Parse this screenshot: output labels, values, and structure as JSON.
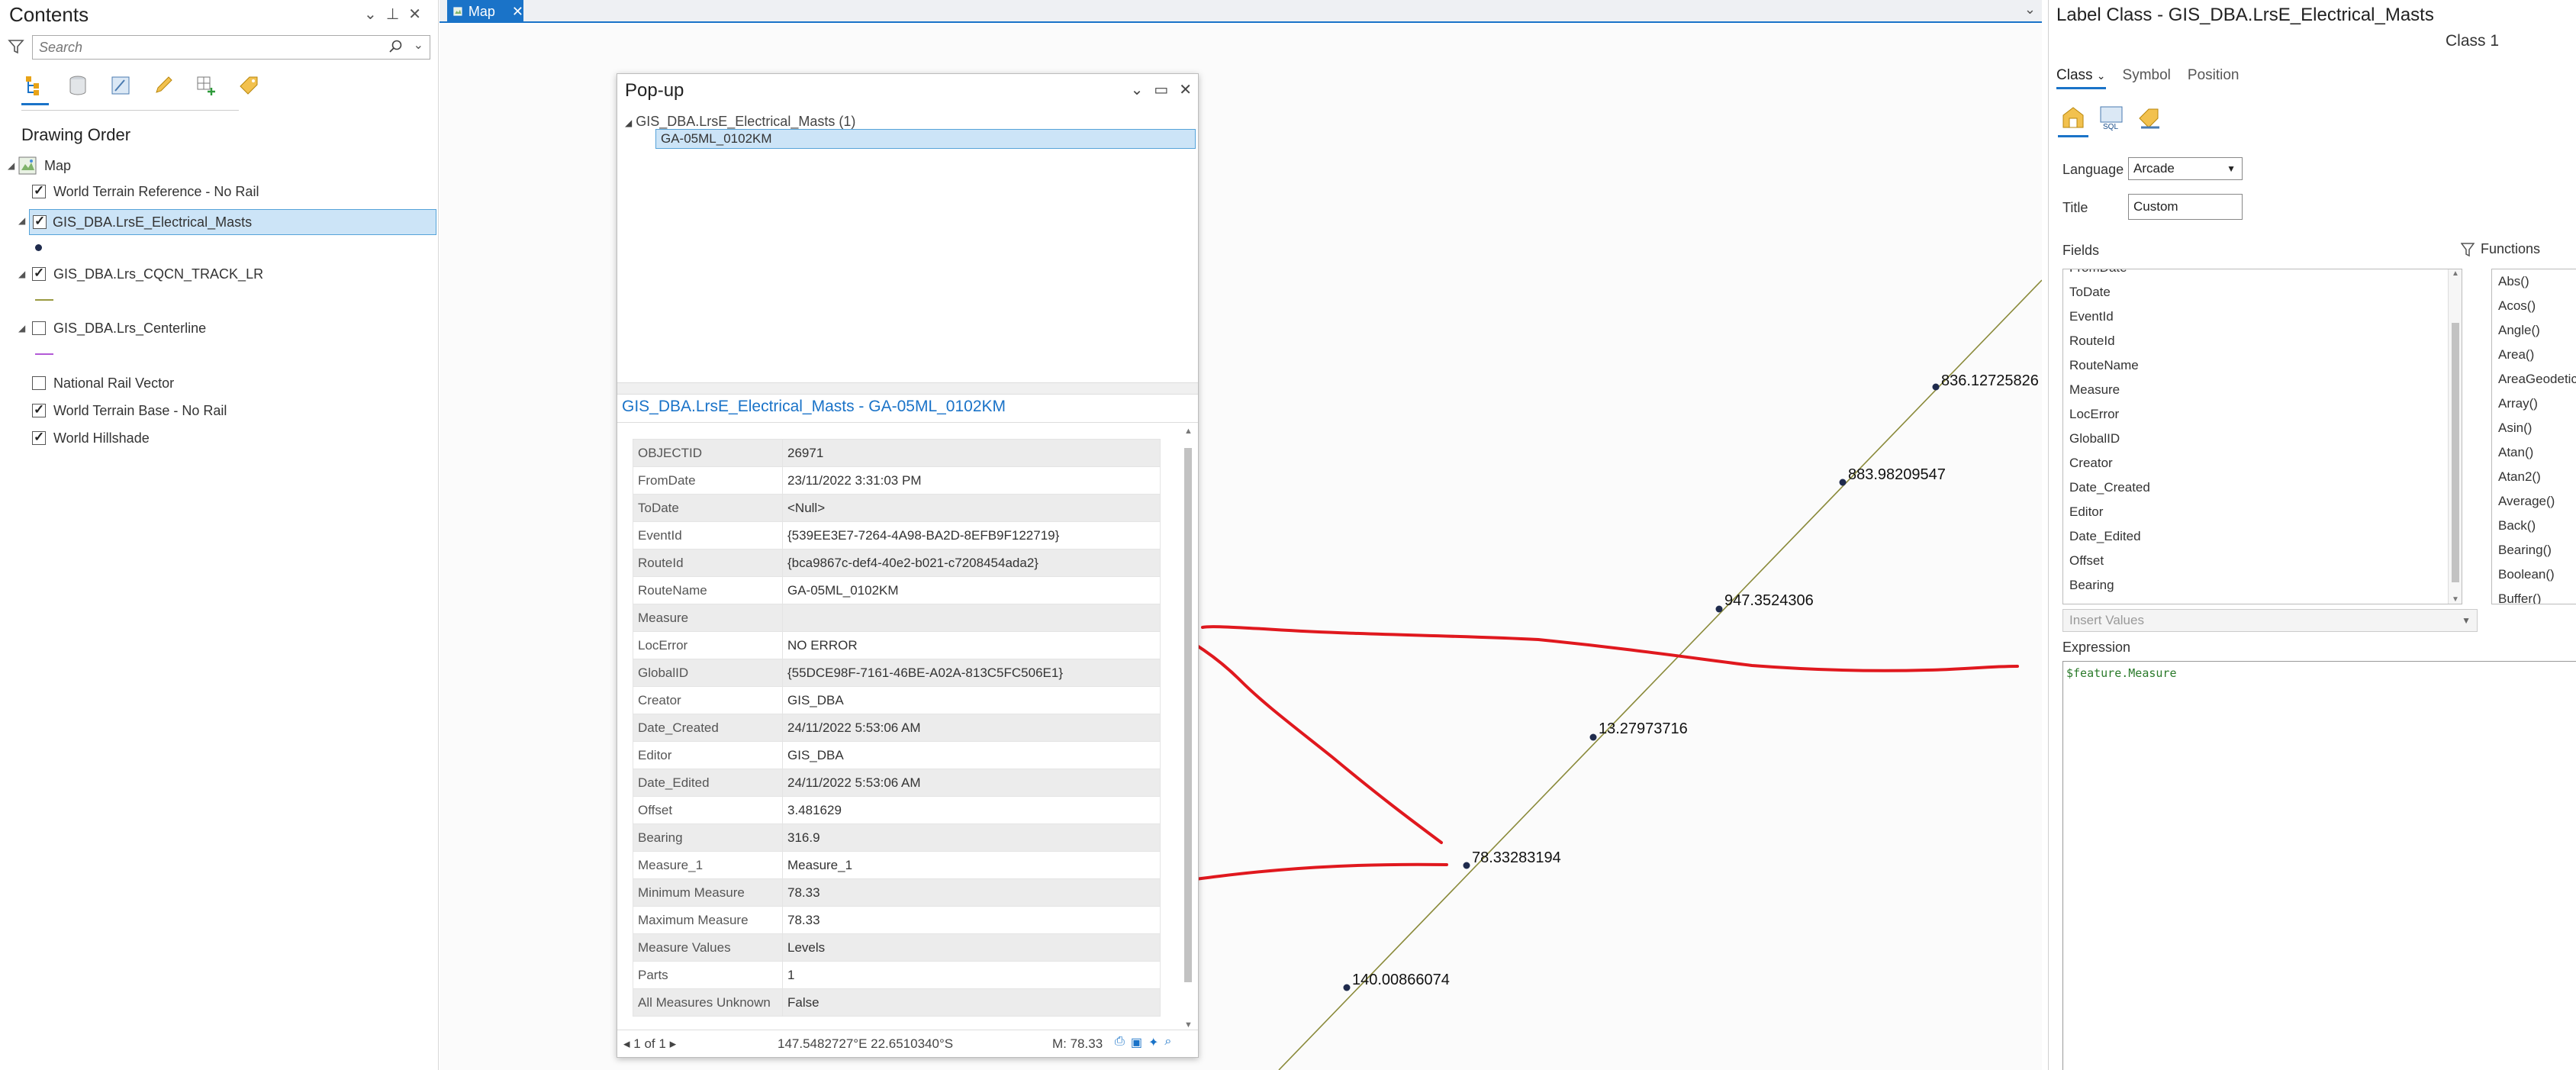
{
  "contents": {
    "title": "Contents",
    "search_placeholder": "Search",
    "drawing_order_label": "Drawing Order",
    "map_label": "Map",
    "layers": [
      {
        "label": "World Terrain Reference - No Rail",
        "checked": true
      },
      {
        "label": "GIS_DBA.LrsE_Electrical_Masts",
        "checked": true,
        "selected": true
      },
      {
        "label": "GIS_DBA.Lrs_CQCN_TRACK_LR",
        "checked": true
      },
      {
        "label": "GIS_DBA.Lrs_Centerline",
        "checked": false
      },
      {
        "label": "National Rail Vector",
        "checked": false
      },
      {
        "label": "World Terrain Base - No Rail",
        "checked": true
      },
      {
        "label": "World Hillshade",
        "checked": true
      }
    ]
  },
  "map_tab": {
    "label": "Map"
  },
  "map": {
    "labels": [
      "836.12725826",
      "883.98209547",
      "947.3524306",
      "13.27973716",
      "78.33283194",
      "140.00866074"
    ],
    "colors": {
      "track": "#8a8a3a",
      "annotation": "#e0181e",
      "point": "#1f2b4d"
    }
  },
  "popup": {
    "title": "Pop-up",
    "tree_parent": "GIS_DBA.LrsE_Electrical_Masts (1)",
    "tree_child": "GA-05ML_0102KM",
    "feature_title": "GIS_DBA.LrsE_Electrical_Masts - GA-05ML_0102KM",
    "attributes": [
      [
        "OBJECTID",
        "26971"
      ],
      [
        "FromDate",
        "23/11/2022 3:31:03 PM"
      ],
      [
        "ToDate",
        "<Null>"
      ],
      [
        "EventId",
        "{539EE3E7-7264-4A98-BA2D-8EFB9F122719}"
      ],
      [
        "RouteId",
        "{bca9867c-def4-40e2-b021-c7208454ada2}"
      ],
      [
        "RouteName",
        "GA-05ML_0102KM"
      ],
      [
        "Measure",
        ""
      ],
      [
        "LocError",
        "NO ERROR"
      ],
      [
        "GlobalID",
        "{55DCE98F-7161-46BE-A02A-813C5FC506E1}"
      ],
      [
        "Creator",
        "GIS_DBA"
      ],
      [
        "Date_Created",
        "24/11/2022 5:53:06 AM"
      ],
      [
        "Editor",
        "GIS_DBA"
      ],
      [
        "Date_Edited",
        "24/11/2022 5:53:06 AM"
      ],
      [
        "Offset",
        "3.481629"
      ],
      [
        "Bearing",
        "316.9"
      ],
      [
        "Measure_1",
        "Measure_1"
      ],
      [
        "Minimum Measure",
        "78.33"
      ],
      [
        "Maximum Measure",
        "78.33"
      ],
      [
        "Measure Values",
        "Levels"
      ],
      [
        "Parts",
        "1"
      ],
      [
        "All Measures Unknown",
        "False"
      ]
    ],
    "footer": {
      "nav": "1 of 1",
      "coords": "147.5482727°E 22.6510340°S",
      "measure": "M: 78.33"
    }
  },
  "label_class": {
    "title": "Label Class - GIS_DBA.LrsE_Electrical_Masts",
    "class_name": "Class 1",
    "tabs": [
      "Class",
      "Symbol",
      "Position"
    ],
    "language_label": "Language",
    "language_value": "Arcade",
    "title_label": "Title",
    "title_value": "Custom",
    "fields_label": "Fields",
    "functions_label": "Functions",
    "fields": [
      "FromDate",
      "ToDate",
      "EventId",
      "RouteId",
      "RouteName",
      "Measure",
      "LocError",
      "GlobalID",
      "Creator",
      "Date_Created",
      "Editor",
      "Date_Edited",
      "Offset",
      "Bearing"
    ],
    "functions": [
      "Abs()",
      "Acos()",
      "Angle()",
      "Area()",
      "AreaGeodetic",
      "Array()",
      "Asin()",
      "Atan()",
      "Atan2()",
      "Average()",
      "Back()",
      "Bearing()",
      "Boolean()",
      "Buffer()"
    ],
    "insert_values": "Insert Values",
    "expression_label": "Expression",
    "expression": "$feature.Measure"
  }
}
